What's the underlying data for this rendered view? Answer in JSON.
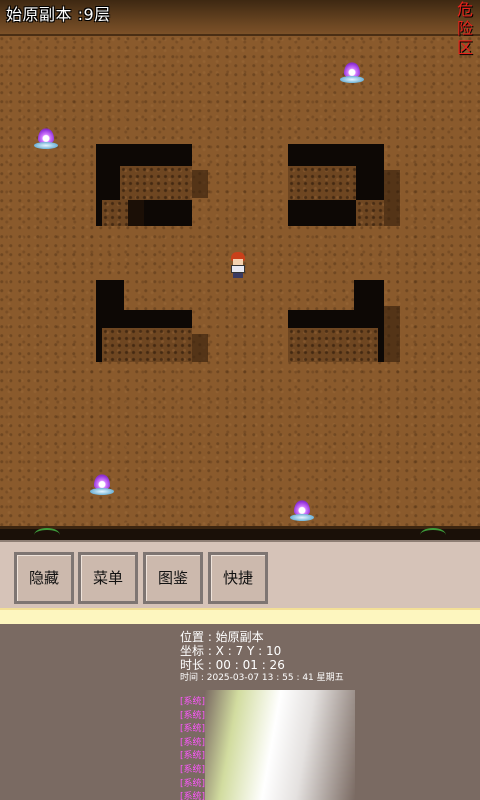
{
  "map": {
    "title": "始原副本 :9层",
    "danger_label": "危险区"
  },
  "panel": {
    "buttons": [
      "隐藏",
      "菜单",
      "图鉴",
      "快捷"
    ]
  },
  "status": {
    "location": "位置 : 始原副本",
    "coords": "坐标 :  X : 7        Y : 10",
    "duration": "时长 :  00 : 01 : 26",
    "time": "时间 : 2025-03-07  13 : 55 : 41  星期五"
  },
  "log": [
    "[系统]",
    "[系统]",
    "[系统]",
    "[系统]",
    "[系统]",
    "[系统]",
    "[系统]",
    "[系统]"
  ],
  "colors": {
    "floor": "#8a5a2c",
    "danger": "#e8211a",
    "panel": "#d6c3b8",
    "info_bg": "#7a6a62",
    "log_text": "#ff57ff"
  },
  "sprites": [
    "player-character",
    "purple-wisp",
    "purple-wisp",
    "purple-wisp",
    "purple-wisp"
  ]
}
